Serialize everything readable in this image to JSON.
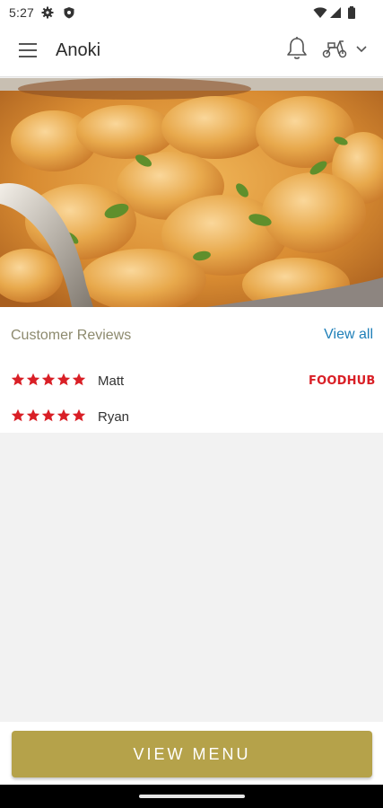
{
  "status_bar": {
    "time": "5:27",
    "left_icons": [
      "gear-icon",
      "shield-icon"
    ],
    "right_icons": [
      "wifi-icon",
      "signal-icon",
      "battery-icon"
    ]
  },
  "app_bar": {
    "title": "Anoki",
    "icons": [
      "hamburger-menu-icon",
      "bell-icon",
      "scooter-icon",
      "chevron-down-icon"
    ]
  },
  "hero": {
    "image": "curry-dish-photo"
  },
  "reviews": {
    "heading": "Customer Reviews",
    "view_all": "View all",
    "items": [
      {
        "rating": 5,
        "name": "Matt",
        "source": "FOODHUB"
      },
      {
        "rating": 5,
        "name": "Ryan",
        "source": ""
      }
    ]
  },
  "footer": {
    "button_label": "VIEW MENU"
  },
  "colors": {
    "accent": "#b5a24a",
    "star": "#d91f26",
    "link": "#1e7fb8",
    "heading": "#8d8a6e",
    "background": "#f2f2f2"
  }
}
